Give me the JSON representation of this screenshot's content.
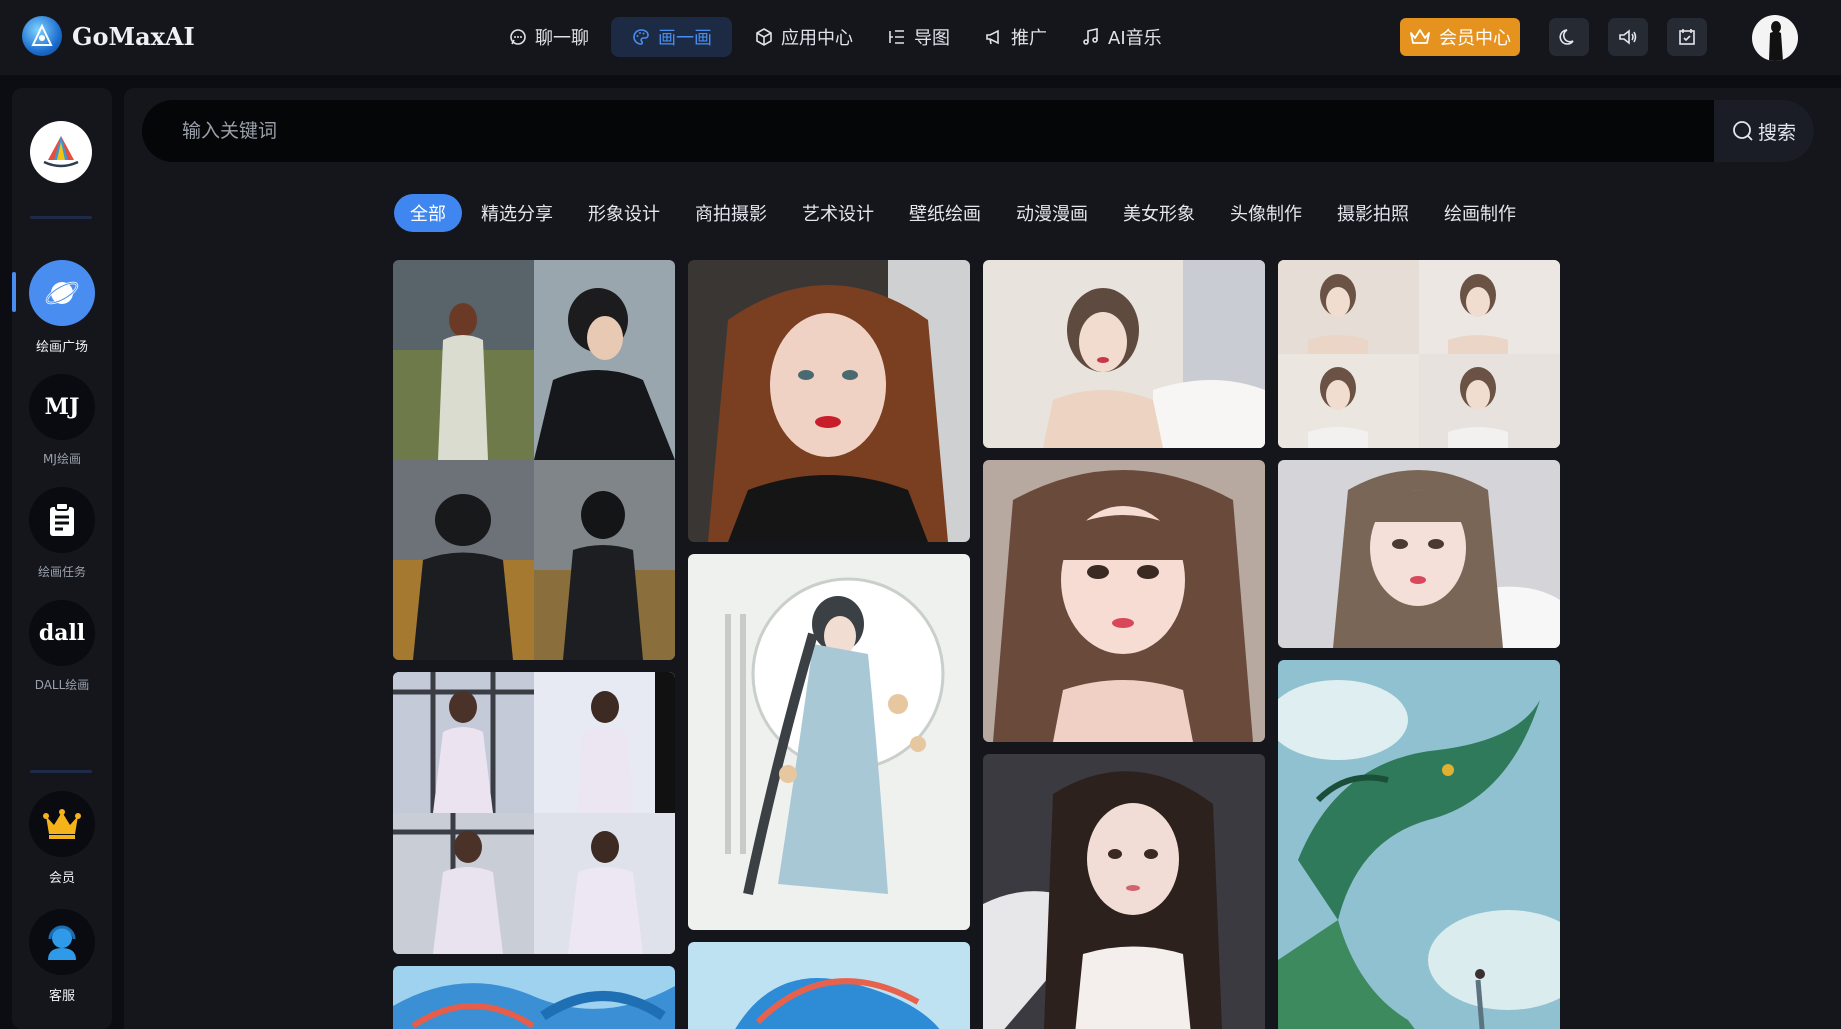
{
  "brand": {
    "name": "GoMaxAI"
  },
  "nav": [
    {
      "label": "聊一聊",
      "icon": "chat-bubble-icon"
    },
    {
      "label": "画一画",
      "icon": "palette-icon",
      "active": true
    },
    {
      "label": "应用中心",
      "icon": "cube-icon"
    },
    {
      "label": "导图",
      "icon": "mindmap-icon"
    },
    {
      "label": "推广",
      "icon": "megaphone-icon"
    },
    {
      "label": "AI音乐",
      "icon": "music-note-icon"
    }
  ],
  "header_actions": {
    "vip_label": "会员中心",
    "icons": [
      "moon-icon",
      "speaker-icon",
      "calendar-check-icon"
    ]
  },
  "sidebar": {
    "items": [
      {
        "label": "绘画广场",
        "icon": "planet-icon",
        "active": true
      },
      {
        "label": "MJ绘画",
        "badge": "MJ"
      },
      {
        "label": "绘画任务",
        "icon": "clipboard-icon"
      },
      {
        "label": "DALL绘画",
        "badge": "dall"
      }
    ],
    "bottom": [
      {
        "label": "会员",
        "icon": "crown-icon"
      },
      {
        "label": "客服",
        "icon": "headset-icon"
      }
    ]
  },
  "search": {
    "placeholder": "输入关键词",
    "button_label": "搜索"
  },
  "categories": [
    "全部",
    "精选分享",
    "形象设计",
    "商拍摄影",
    "艺术设计",
    "壁纸绘画",
    "动漫漫画",
    "美女形象",
    "头像制作",
    "摄影拍照",
    "绘画制作"
  ],
  "active_category": "全部",
  "colors": {
    "accent": "#3f86f0",
    "vip": "#e6921f",
    "background": "#0b0d12",
    "panel": "#14161c"
  }
}
